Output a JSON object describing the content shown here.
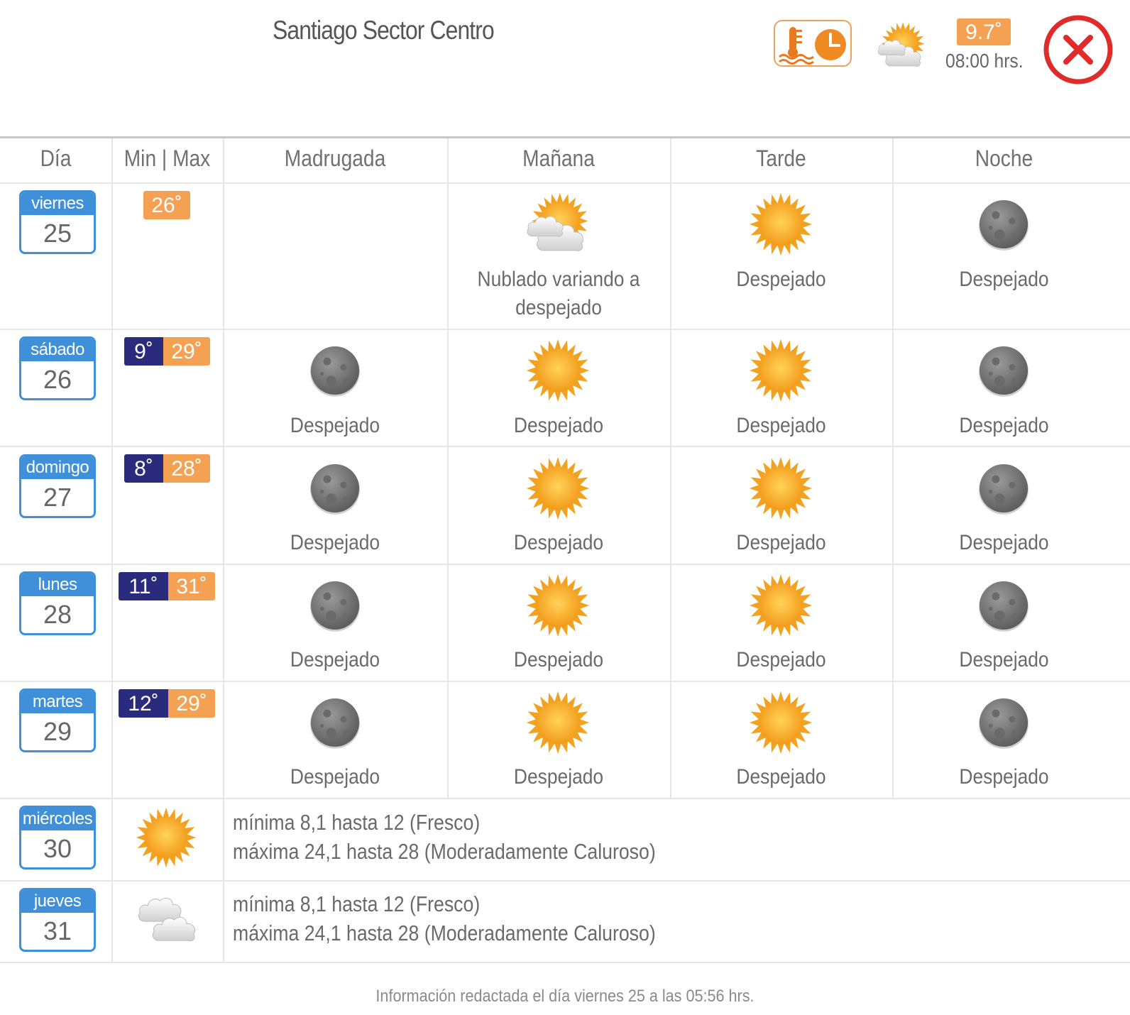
{
  "header": {
    "title": "Santiago Sector Centro",
    "current_icon": "partly-cloudy-icon",
    "current_temp": "9.7˚",
    "current_time": "08:00 hrs."
  },
  "columns": [
    "Día",
    "Min | Max",
    "Madrugada",
    "Mañana",
    "Tarde",
    "Noche"
  ],
  "days": [
    {
      "name": "viernes",
      "num": "25",
      "min": "",
      "max": "26˚",
      "periods": [
        {
          "icon": "",
          "text": ""
        },
        {
          "icon": "partly-cloudy-icon",
          "text": "Nublado variando a despejado"
        },
        {
          "icon": "sun-icon",
          "text": "Despejado"
        },
        {
          "icon": "moon-icon",
          "text": "Despejado"
        }
      ]
    },
    {
      "name": "sábado",
      "num": "26",
      "min": "9˚",
      "max": "29˚",
      "periods": [
        {
          "icon": "moon-icon",
          "text": "Despejado"
        },
        {
          "icon": "sun-icon",
          "text": "Despejado"
        },
        {
          "icon": "sun-icon",
          "text": "Despejado"
        },
        {
          "icon": "moon-icon",
          "text": "Despejado"
        }
      ]
    },
    {
      "name": "domingo",
      "num": "27",
      "min": "8˚",
      "max": "28˚",
      "periods": [
        {
          "icon": "moon-icon",
          "text": "Despejado"
        },
        {
          "icon": "sun-icon",
          "text": "Despejado"
        },
        {
          "icon": "sun-icon",
          "text": "Despejado"
        },
        {
          "icon": "moon-icon",
          "text": "Despejado"
        }
      ]
    },
    {
      "name": "lunes",
      "num": "28",
      "min": "11˚",
      "max": "31˚",
      "periods": [
        {
          "icon": "moon-icon",
          "text": "Despejado"
        },
        {
          "icon": "sun-icon",
          "text": "Despejado"
        },
        {
          "icon": "sun-icon",
          "text": "Despejado"
        },
        {
          "icon": "moon-icon",
          "text": "Despejado"
        }
      ]
    },
    {
      "name": "martes",
      "num": "29",
      "min": "12˚",
      "max": "29˚",
      "periods": [
        {
          "icon": "moon-icon",
          "text": "Despejado"
        },
        {
          "icon": "sun-icon",
          "text": "Despejado"
        },
        {
          "icon": "sun-icon",
          "text": "Despejado"
        },
        {
          "icon": "moon-icon",
          "text": "Despejado"
        }
      ]
    }
  ],
  "extended": [
    {
      "name": "miércoles",
      "num": "30",
      "icon": "sun-icon",
      "line1": "mínima 8,1 hasta 12 (Fresco)",
      "line2": "máxima 24,1 hasta 28 (Moderadamente Caluroso)"
    },
    {
      "name": "jueves",
      "num": "31",
      "icon": "cloudy-icon",
      "line1": "mínima 8,1 hasta 12 (Fresco)",
      "line2": "máxima 24,1 hasta 28 (Moderadamente Caluroso)"
    }
  ],
  "footer": "Información redactada el día viernes 25 a las 05:56 hrs.",
  "colors": {
    "accent_blue": "#3f90d8",
    "min_navy": "#2b2b7d",
    "max_orange": "#f4a154",
    "close_red": "#e02b2b"
  }
}
